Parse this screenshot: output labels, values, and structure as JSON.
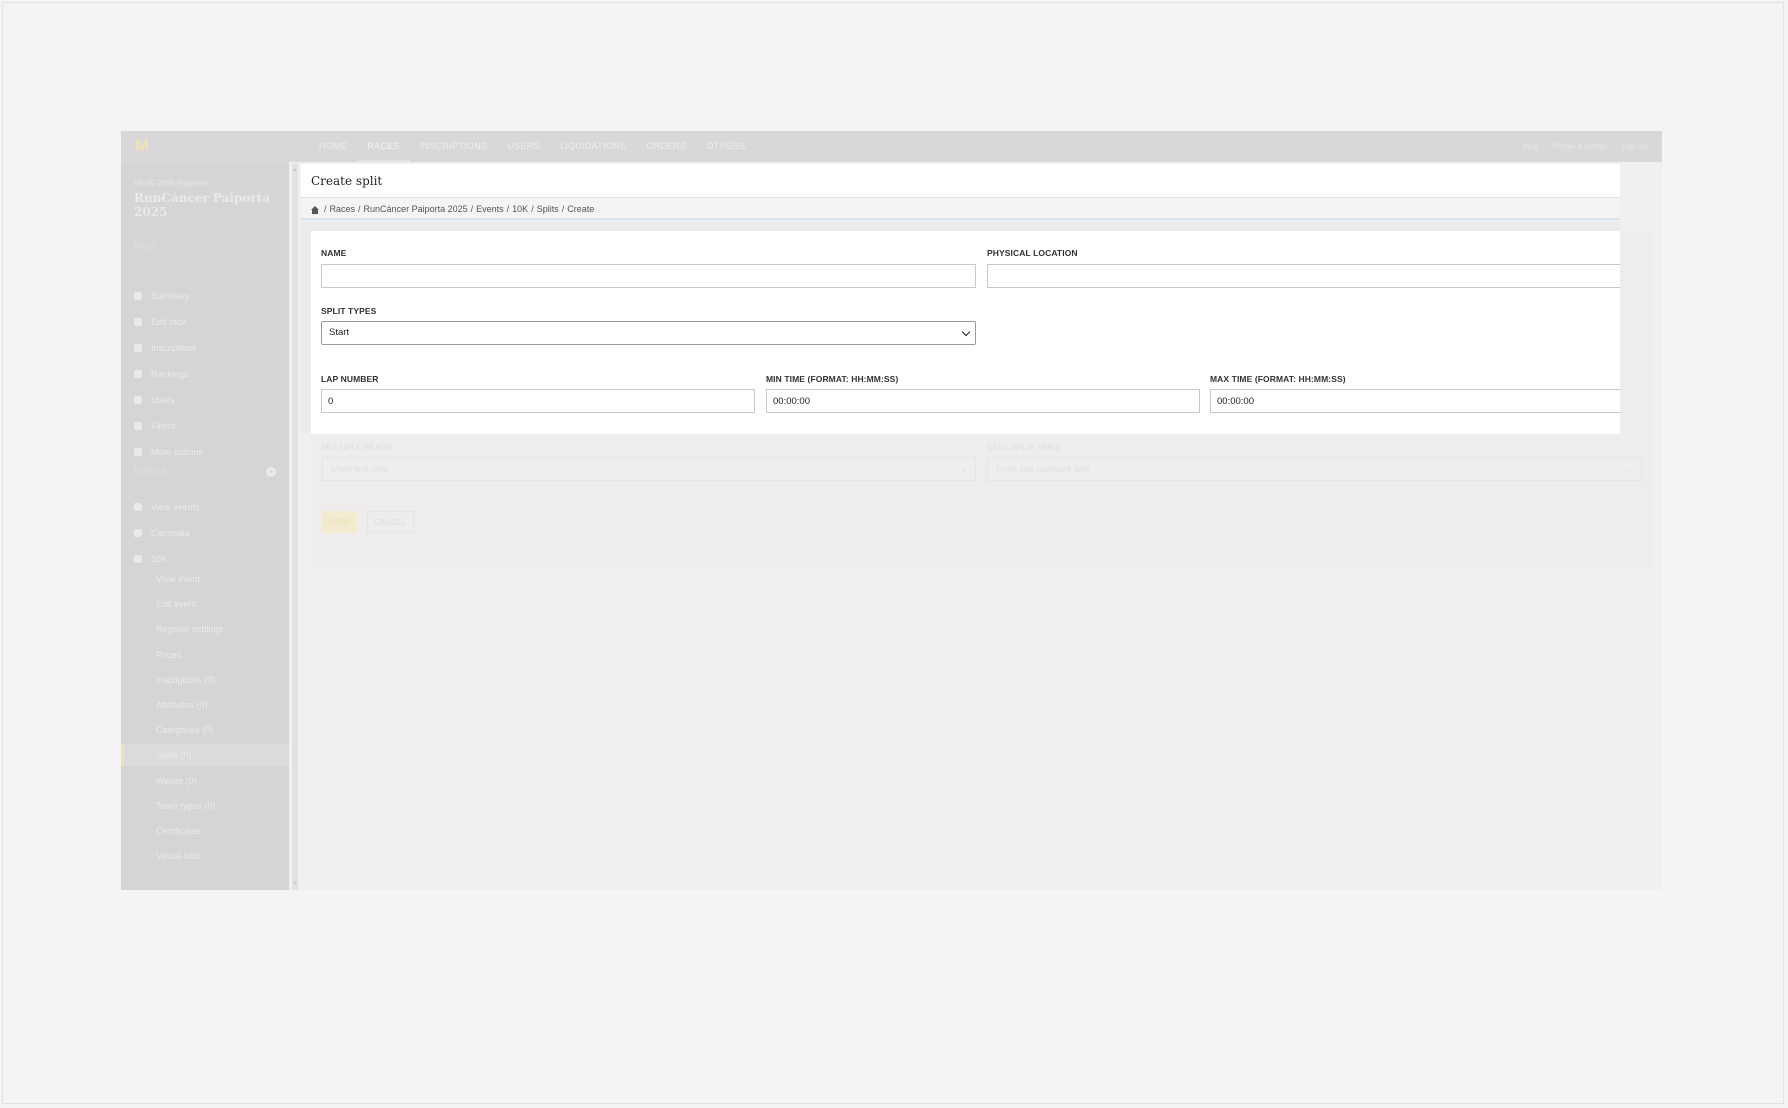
{
  "navbar": {
    "items": [
      "HOME",
      "RACES",
      "INSCRIPTIONS",
      "USERS",
      "LIQUIDATIONS",
      "ORDERS",
      "OTHERS"
    ],
    "active_index": 1,
    "right": [
      "Help",
      "Profile & Admin",
      "Log out"
    ]
  },
  "sidebar": {
    "date": "09-05-2025 Palporta",
    "race_title": "RunCáncer Paiporta 2025",
    "race_heading": "RACE",
    "race_items": [
      "Summary",
      "Edit race",
      "Inscriptions",
      "Rankings",
      "Users",
      "Filters",
      "More options"
    ],
    "events_heading": "EVENTS",
    "event_items": [
      "View events",
      "Caminata",
      "10K"
    ],
    "event_sub_items": [
      "View event",
      "Edit event",
      "Register settings",
      "Prices",
      "Inscriptions (0)",
      "Attributes (0)",
      "Categories (0)",
      "Splits (0)",
      "Waves (0)",
      "Team types (0)",
      "Certificates",
      "Virtual bibs"
    ],
    "active_sub_index": 7
  },
  "modal": {
    "title": "Create split",
    "breadcrumb": [
      "Races",
      "RunCáncer Paiporta 2025",
      "Events",
      "10K",
      "Splits",
      "Create"
    ]
  },
  "form": {
    "name": {
      "label": "NAME",
      "value": ""
    },
    "physical_location": {
      "label": "PHYSICAL LOCATION",
      "value": ""
    },
    "split_types": {
      "label": "SPLIT TYPES",
      "value": "Start"
    },
    "lap_number": {
      "label": "LAP NUMBER",
      "value": "0"
    },
    "min_time": {
      "label": "MIN TIME (FORMAT: HH:MM:SS)",
      "value": "00:00:00"
    },
    "max_time": {
      "label": "MAX TIME (FORMAT: HH:MM:SS)",
      "value": "00:00:00"
    },
    "multiple_reads": {
      "label": "MULTIPLE READS",
      "value": "Used first time"
    },
    "calc_split_times": {
      "label": "CALC SPLIT TIMES",
      "value": "From last standard split"
    },
    "save_label": "SAVE",
    "cancel_label": "CANCEL"
  },
  "colors": {
    "accent": "#efe4b4",
    "overlay_bg": "#f5f3f4",
    "modal_bg": "#ffffff"
  }
}
